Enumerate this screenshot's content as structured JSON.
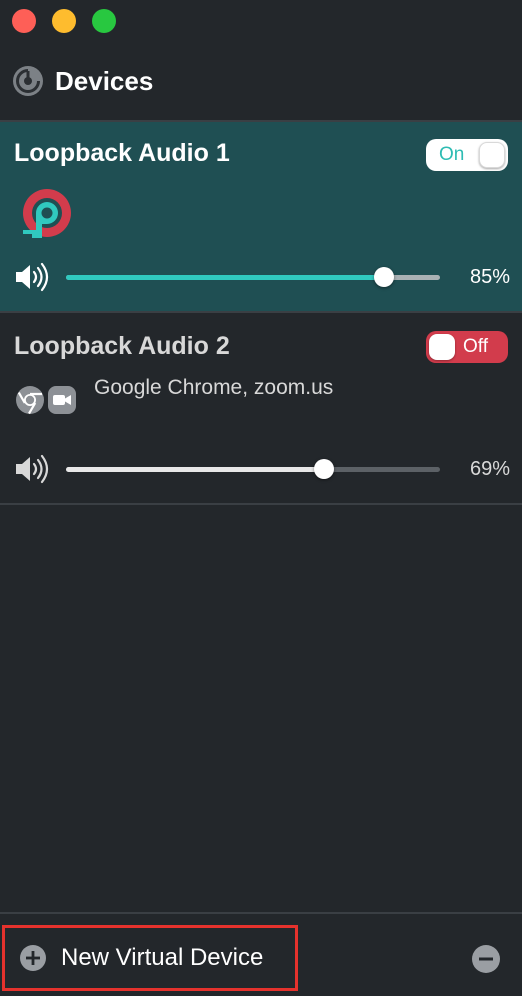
{
  "window": {
    "title": "Devices"
  },
  "devices": [
    {
      "name": "Loopback Audio 1",
      "toggle_label": "On",
      "toggle_state": "on",
      "volume_percent": 85,
      "volume_text": "85%",
      "icon": "loopback-logo-icon"
    },
    {
      "name": "Loopback Audio 2",
      "toggle_label": "Off",
      "toggle_state": "off",
      "sources_text": "Google Chrome, zoom.us",
      "source_icons": [
        "chrome-icon",
        "zoom-icon"
      ],
      "volume_percent": 69,
      "volume_text": "69%"
    }
  ],
  "footer": {
    "new_device_label": "New Virtual Device",
    "add_icon": "plus-circle-icon",
    "remove_icon": "minus-circle-icon"
  },
  "colors": {
    "background": "#23272b",
    "selected_device": "#1f4f53",
    "accent_teal": "#30c9bf",
    "toggle_off_red": "#d23c4c",
    "highlight_red": "#e5322d"
  }
}
